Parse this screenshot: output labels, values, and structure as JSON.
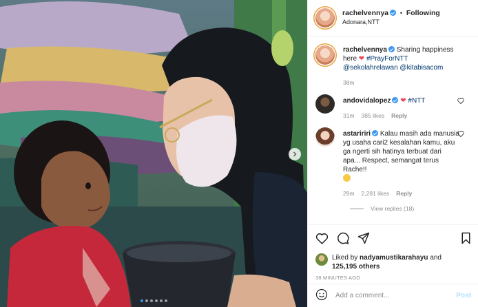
{
  "post": {
    "username": "rachelvennya",
    "follow_status": "Following",
    "separator": "•",
    "location": "Adonara,NTT",
    "carousel_dots": 6,
    "active_dot": 0
  },
  "caption": {
    "username": "rachelvennya",
    "text": "Sharing happiness here",
    "heart": "❤",
    "hashtag": "#PrayForNTT",
    "mention1": "@sekolahrelawan",
    "mention2": "@kitabisacom",
    "time": "38m"
  },
  "comments": [
    {
      "username": "andovidalopez",
      "heart": "❤",
      "text": "#NTT",
      "time": "31m",
      "likes": "385 likes",
      "reply": "Reply"
    },
    {
      "username": "astaririri",
      "text": "Kalau masih ada manusia yg usaha cari2 kesalahan kamu, aku ga ngerti sih hatinya terbuat dari apa... Respect, semangat terus Rache!!",
      "time": "29m",
      "likes": "2,281 likes",
      "reply": "Reply",
      "view_replies": "View replies (18)"
    }
  ],
  "actions": {
    "liked_by_prefix": "Liked by",
    "liked_by_user": "nadyamustikarahayu",
    "and": "and",
    "others": "125,195 others",
    "timestamp": "38 MINUTES AGO"
  },
  "add_comment": {
    "placeholder": "Add a comment...",
    "post_label": "Post"
  },
  "colors": {
    "accent_blue": "#3897f0",
    "link_blue": "#00376b",
    "heart_red": "#ed4956",
    "muted_gray": "#8e8e8e",
    "post_disabled": "#b2dffc"
  }
}
